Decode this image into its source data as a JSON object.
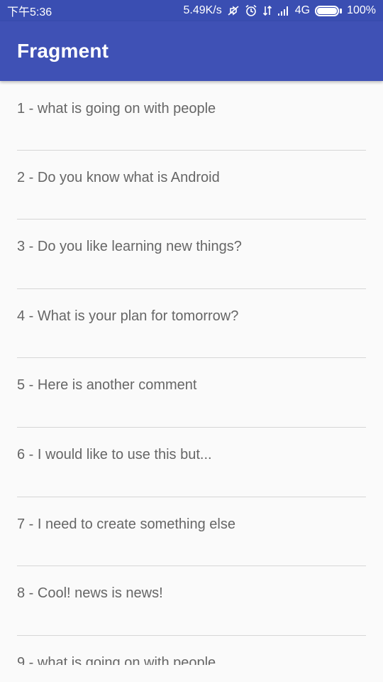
{
  "status_bar": {
    "time": "下午5:36",
    "network_speed": "5.49K/s",
    "network_type": "4G",
    "battery": "100%",
    "battery_level": 1.0,
    "icons": [
      "mute-icon",
      "alarm-icon",
      "data-transfer-icon",
      "signal-icon",
      "battery-icon"
    ]
  },
  "app_bar": {
    "title": "Fragment"
  },
  "list": {
    "items": [
      {
        "label": "1 - what is going on with people"
      },
      {
        "label": "2 - Do you know what is Android"
      },
      {
        "label": "3 - Do you like learning new things?"
      },
      {
        "label": "4 - What is your plan for tomorrow?"
      },
      {
        "label": "5 - Here is another comment"
      },
      {
        "label": "6 - I would like to use this but..."
      },
      {
        "label": "7 - I need to create something else"
      },
      {
        "label": "8 - Cool! news is news!"
      },
      {
        "label": "9 - what is going on with people"
      }
    ]
  },
  "colors": {
    "primary": "#3f51b5",
    "primary_dark": "#3a4eb2",
    "background": "#fafafa",
    "text": "#666666",
    "divider": "#d6d6d6"
  }
}
